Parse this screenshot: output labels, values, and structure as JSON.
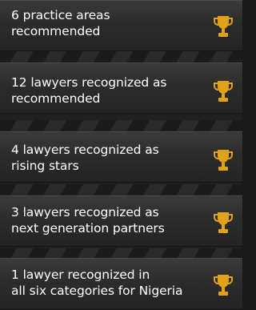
{
  "accent_color": "#e0a21a",
  "items": [
    {
      "label": "6 practice areas\nrecommended",
      "icon": "trophy-icon"
    },
    {
      "label": "12 lawyers recognized as\nrecommended",
      "icon": "trophy-icon"
    },
    {
      "label": "4  lawyers recognized as\nrising stars",
      "icon": "trophy-icon"
    },
    {
      "label": "3 lawyers recognized as\nnext generation partners",
      "icon": "trophy-icon"
    },
    {
      "label": "1 lawyer recognized in\nall six categories for Nigeria",
      "icon": "trophy-icon"
    }
  ]
}
